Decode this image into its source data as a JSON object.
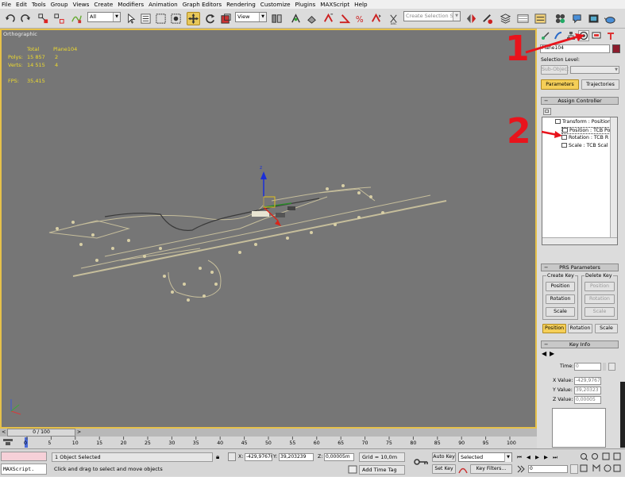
{
  "menubar": {
    "items": [
      "File",
      "Edit",
      "Tools",
      "Group",
      "Views",
      "Create",
      "Modifiers",
      "Animation",
      "Graph Editors",
      "Rendering",
      "Customize",
      "Plugins",
      "MAXScript",
      "Help"
    ]
  },
  "toolbar": {
    "filter_value": "All",
    "refcoord_value": "View",
    "named_selection_placeholder": "Create Selection Set"
  },
  "viewport": {
    "label": "Orthographic",
    "stats": {
      "total_label": "Total",
      "object_label": "Plane104",
      "polys_label": "Polys:",
      "polys_total": "15 857",
      "polys_obj": "2",
      "verts_label": "Verts:",
      "verts_total": "14 515",
      "verts_obj": "4",
      "fps_label": "FPS:",
      "fps_value": "35,415"
    },
    "gizmo_axis_label": "z"
  },
  "command_panel": {
    "object_name": "Plane104",
    "object_color": "#8c1c2c",
    "selection_level_label": "Selection Level:",
    "sub_object_label": "Sub-Object",
    "tabs": {
      "parameters": "Parameters",
      "trajectories": "Trajectories"
    },
    "assign_controller": {
      "title": "Assign Controller",
      "tree": [
        "Transform : Position/",
        "Position : TCB Po",
        "Rotation : TCB R",
        "Scale : TCB Scal"
      ]
    },
    "prs": {
      "title": "PRS Parameters",
      "create_key": "Create Key",
      "delete_key": "Delete Key",
      "position": "Position",
      "rotation": "Rotation",
      "scale": "Scale"
    },
    "key_info": {
      "title": "Key Info",
      "time_label": "Time:",
      "time_value": "0",
      "x_label": "X Value:",
      "x_value": "-429,9767",
      "y_label": "Y Value:",
      "y_value": "39,20323",
      "z_label": "Z Value:",
      "z_value": "0,00005"
    }
  },
  "timeline": {
    "slider_label": "0 / 100",
    "ticks": [
      "0",
      "5",
      "10",
      "15",
      "20",
      "25",
      "30",
      "35",
      "40",
      "45",
      "50",
      "55",
      "60",
      "65",
      "70",
      "75",
      "80",
      "85",
      "90",
      "95",
      "100"
    ]
  },
  "status": {
    "selected_text": "1 Object Selected",
    "prompt_text": "Click and drag to select and move objects",
    "maxscript_label": "MAXScript.",
    "x_label": "X:",
    "x_value": "-429,9767(",
    "y_label": "Y:",
    "y_value": "39,203239",
    "z_label": "Z:",
    "z_value": "0,00005m",
    "grid_text": "Grid = 10,0m",
    "add_time_tag": "Add Time Tag",
    "auto_key": "Auto Key",
    "set_key": "Set Key",
    "key_mode_value": "Selected",
    "key_filters": "Key Filters...",
    "frame_value": "0"
  },
  "annotations": {
    "one": "1",
    "two": "2"
  }
}
